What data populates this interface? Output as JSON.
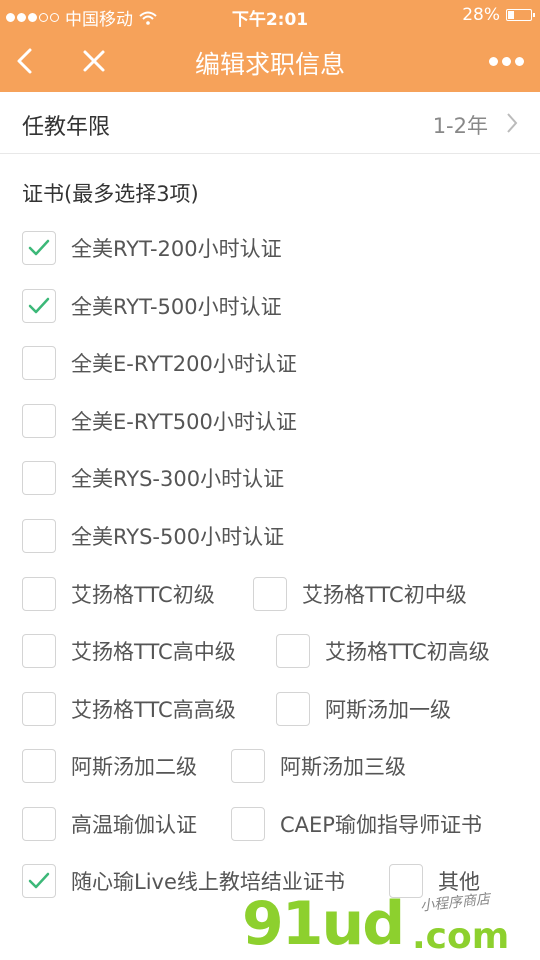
{
  "status_bar": {
    "carrier": "中国移动",
    "time": "下午2:01",
    "battery_percent": "28%",
    "battery_level": 0.28,
    "signal_dots_filled": 3,
    "signal_dots_total": 5
  },
  "nav": {
    "title": "编辑求职信息",
    "back_icon": "chevron-left-icon",
    "close_icon": "close-icon",
    "more_icon": "more-dots-icon"
  },
  "teaching_years": {
    "label": "任教年限",
    "value": "1-2年"
  },
  "certificates": {
    "title": "证书(最多选择3项)",
    "options": [
      {
        "label": "全美RYT-200小时认证",
        "checked": true
      },
      {
        "label": "全美RYT-500小时认证",
        "checked": true
      },
      {
        "label": "全美E-RYT200小时认证",
        "checked": false
      },
      {
        "label": "全美E-RYT500小时认证",
        "checked": false
      },
      {
        "label": "全美RYS-300小时认证",
        "checked": false
      },
      {
        "label": "全美RYS-500小时认证",
        "checked": false
      },
      {
        "label": "艾扬格TTC初级",
        "checked": false
      },
      {
        "label": "艾扬格TTC初中级",
        "checked": false
      },
      {
        "label": "艾扬格TTC高中级",
        "checked": false
      },
      {
        "label": "艾扬格TTC初高级",
        "checked": false
      },
      {
        "label": "艾扬格TTC高高级",
        "checked": false
      },
      {
        "label": "阿斯汤加一级",
        "checked": false
      },
      {
        "label": "阿斯汤加二级",
        "checked": false
      },
      {
        "label": "阿斯汤加三级",
        "checked": false
      },
      {
        "label": "高温瑜伽认证",
        "checked": false
      },
      {
        "label": "CAEP瑜伽指导师证书",
        "checked": false
      },
      {
        "label": "随心瑜Live线上教培结业证书",
        "checked": true
      },
      {
        "label": "其他",
        "checked": false
      }
    ]
  },
  "watermark": {
    "logo": "91ud",
    "domain": ".com",
    "tagline": "小程序商店"
  },
  "colors": {
    "accent": "#f6a25a",
    "check": "#3cb878",
    "watermark": "#8dd02e"
  }
}
